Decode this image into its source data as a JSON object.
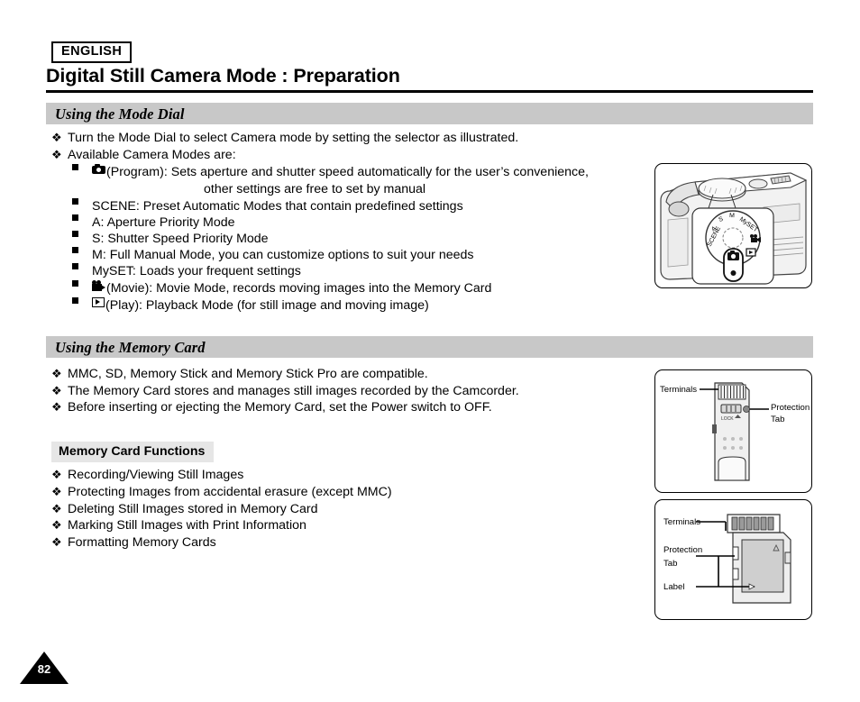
{
  "header": {
    "language_badge": "ENGLISH",
    "title": "Digital Still Camera Mode : Preparation"
  },
  "sections": [
    {
      "id": "mode-dial",
      "heading": "Using the Mode Dial",
      "items": [
        "Turn the Mode Dial to select Camera mode by setting the selector as illustrated.",
        "Available Camera Modes are:"
      ],
      "modes": [
        {
          "icon": "camera-icon",
          "text": "(Program): Sets aperture and shutter speed automatically for the user’s convenience,",
          "continuation": "other settings are free to set by manual"
        },
        {
          "icon": "",
          "text": "SCENE: Preset Automatic Modes that contain predefined settings"
        },
        {
          "icon": "",
          "text": "A: Aperture Priority Mode"
        },
        {
          "icon": "",
          "text": "S: Shutter Speed Priority Mode"
        },
        {
          "icon": "",
          "text": "M: Full Manual Mode, you can customize options to suit your needs"
        },
        {
          "icon": "",
          "text": "MySET: Loads your frequent settings"
        },
        {
          "icon": "movie-icon",
          "text": "(Movie): Movie Mode, records moving images into the Memory Card"
        },
        {
          "icon": "play-icon",
          "text": "(Play): Playback Mode (for still image and moving image)"
        }
      ]
    },
    {
      "id": "memory-card",
      "heading": "Using the Memory Card",
      "items": [
        "MMC, SD, Memory Stick and Memory Stick Pro are compatible.",
        "The Memory Card stores and manages still images recorded by the Camcorder.",
        "Before inserting or ejecting the Memory Card, set the Power switch to OFF."
      ],
      "subheading": "Memory Card Functions",
      "functions": [
        "Recording/Viewing Still Images",
        "Protecting Images from accidental erasure (except MMC)",
        "Deleting Still Images stored in Memory Card",
        "Marking Still Images with Print Information",
        "Formatting Memory Cards"
      ]
    }
  ],
  "illustrations": {
    "mode_dial": {
      "dial_labels": [
        "SCENE",
        "A",
        "S",
        "M",
        "MySET"
      ]
    },
    "memory_stick": {
      "label_terminals": "Terminals",
      "label_protection_tab_line1": "Protection",
      "label_protection_tab_line2": "Tab",
      "lock_text": "LOCK"
    },
    "sd_card": {
      "label_terminals": "Terminals",
      "label_protection_tab_line1": "Protection",
      "label_protection_tab_line2": "Tab",
      "label_label": "Label"
    }
  },
  "footer": {
    "page_number": "82"
  },
  "colors": {
    "section_bar": "#c8c8c8",
    "subhead_bg": "#e6e6e6",
    "text": "#000000",
    "page_bg": "#ffffff"
  }
}
